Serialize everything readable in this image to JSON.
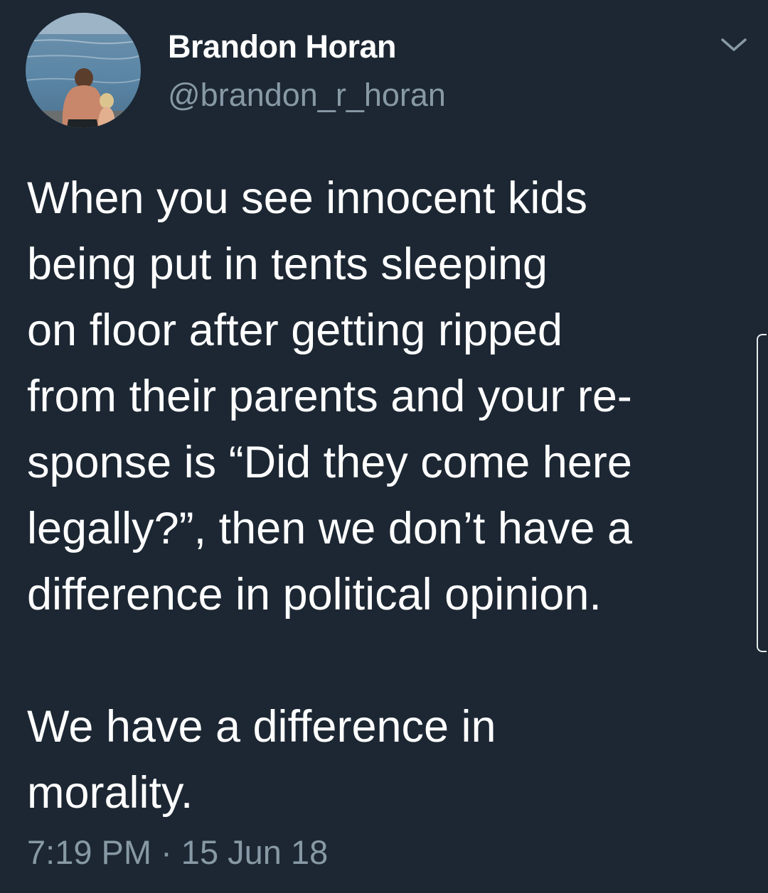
{
  "author": {
    "name": "Brandon Horan",
    "handle": "@brandon_r_horan",
    "avatar_icon": "avatar-photo-beach"
  },
  "menu": {
    "icon": "chevron-down-icon"
  },
  "tweet": {
    "paragraph_1": "When you see innocent kids\nbeing put in tents sleeping\non floor after getting ripped\nfrom their parents and your re-\nsponse is “Did they come here\nlegally?”, then we don’t have a\ndifference in political opinion.",
    "paragraph_2": "We have a difference in\nmorality.",
    "timestamp": "7:19 PM · 15 Jun 18"
  },
  "colors": {
    "background": "#1c2733",
    "secondary_text": "#8899a6",
    "primary_text": "#ffffff"
  }
}
